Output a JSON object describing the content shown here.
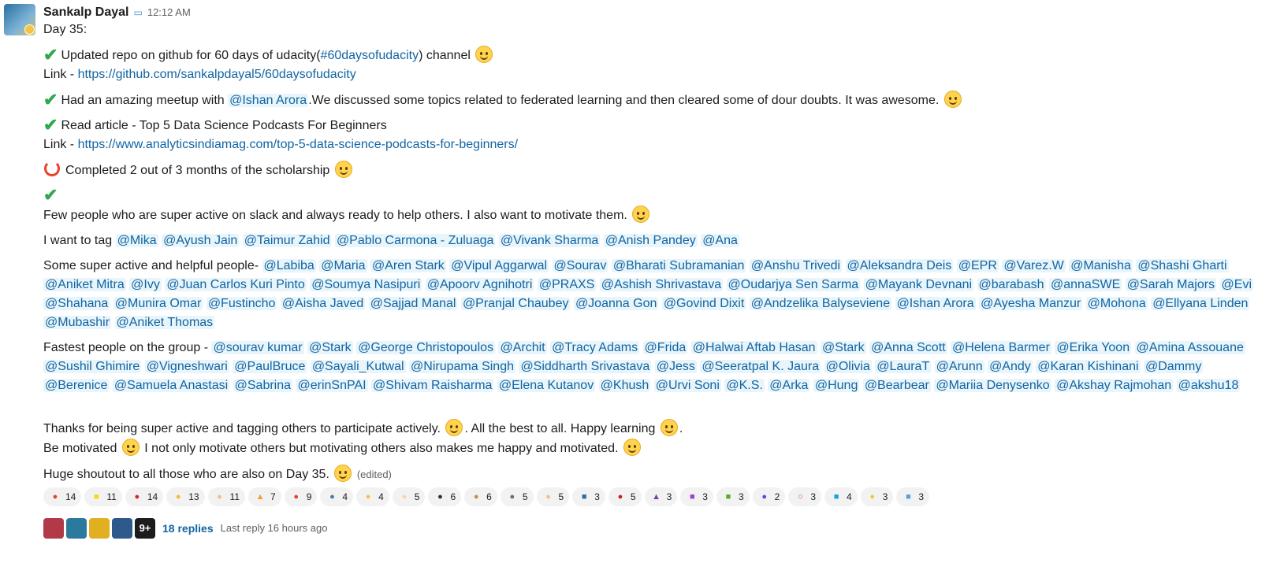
{
  "author": "Sankalp Dayal",
  "status_icon": "speech-balloon",
  "time": "12:12 AM",
  "day_line": "Day 35:",
  "item1": {
    "text_a": "Updated repo on github for 60 days of udacity(",
    "channel": "#60daysofudacity",
    "text_b": ")  channel"
  },
  "link_label": "Link - ",
  "link1": "https://github.com/sankalpdayal5/60daysofudacity",
  "item2": {
    "text_a": "Had an amazing meetup with ",
    "mention": "@Ishan Arora",
    "text_b": ".We discussed some topics related to federated learning and then cleared some of dour doubts. It was awesome."
  },
  "item3": "Read article - Top 5 Data Science Podcasts For Beginners",
  "link2": "https://www.analyticsindiamag.com/top-5-data-science-podcasts-for-beginners/",
  "item4": "Completed 2 out of 3 months of the scholarship",
  "item5": "Few people who are super active on slack and always ready to help others. I also want to motivate them.",
  "tag_intro": "I want to tag ",
  "tag_mentions": [
    "@Mika",
    "@Ayush Jain",
    "@Taimur Zahid",
    "@Pablo Carmona - Zuluaga",
    "@Vivank Sharma",
    "@Anish Pandey",
    "@Ana"
  ],
  "helpful_intro": "Some super active and helpful people- ",
  "helpful_mentions": [
    "@Labiba",
    "@Maria",
    "@Aren Stark",
    "@Vipul Aggarwal",
    "@Sourav",
    "@Bharati Subramanian",
    "@Anshu Trivedi",
    "@Aleksandra Deis",
    "@EPR",
    "@Varez.W",
    "@Manisha",
    "@Shashi Gharti",
    "@Aniket Mitra",
    "@Ivy",
    "@Juan Carlos Kuri Pinto",
    "@Soumya Nasipuri",
    "@Apoorv Agnihotri",
    "@PRAXS",
    "@Ashish Shrivastava",
    "@Oudarjya Sen Sarma",
    "@Mayank Devnani",
    "@barabash",
    "@annaSWE",
    "@Sarah Majors",
    "@Evi",
    "@Shahana",
    "@Munira Omar",
    "@Fustincho",
    "@Aisha Javed",
    "@Sajjad Manal",
    "@Pranjal Chaubey",
    "@Joanna Gon",
    "@Govind Dixit",
    "@Andzelika Balyseviene",
    "@Ishan Arora",
    "@Ayesha Manzur",
    "@Mohona",
    "@Ellyana Linden",
    "@Mubashir",
    "@Aniket Thomas"
  ],
  "fastest_intro": "Fastest people on the group - ",
  "fastest_mentions": [
    "@sourav kumar",
    "@Stark",
    "@George Christopoulos",
    "@Archit",
    "@Tracy Adams",
    "@Frida",
    "@Halwai Aftab Hasan",
    "@Stark",
    "@Anna Scott",
    "@Helena Barmer",
    "@Erika Yoon",
    "@Amina Assouane",
    "@Sushil Ghimire",
    "@Vigneshwari",
    "@PaulBruce",
    "@Sayali_Kutwal",
    "@Nirupama Singh",
    "@Siddharth Srivastava",
    "@Jess",
    "@Seeratpal K. Jaura",
    "@Olivia",
    "@LauraT",
    "@Arunn",
    "@Andy",
    "@Karan Kishinani",
    "@Dammy",
    "@Berenice",
    "@Samuela Anastasi",
    "@Sabrina",
    "@erinSnPAI",
    "@Shivam Raisharma",
    "@Elena Kutanov",
    "@Khush",
    "@Urvi Soni",
    "@K.S.",
    "@Arka",
    "@Hung",
    "@Bearbear",
    "@Mariia Denysenko",
    "@Akshay Rajmohan",
    "@akshu18"
  ],
  "thanks_a": "Thanks for being super active and tagging others to participate actively. ",
  "thanks_b": ". All the best to all. Happy learning ",
  "thanks_c": ".",
  "motivated_a": "Be motivated ",
  "motivated_b": " I not only motivate others but motivating others also makes me happy and motivated.",
  "shoutout": "Huge shoutout to all those who are also on Day 35.",
  "edited": "(edited)",
  "reactions": [
    {
      "icon": "100-flame-icon",
      "color": "#e8412c",
      "glyph": "●",
      "count": "14"
    },
    {
      "icon": "yellow-square-icon",
      "color": "#f5d90a",
      "glyph": "■",
      "count": "11"
    },
    {
      "icon": "fire-circle-icon",
      "color": "#d6261b",
      "glyph": "●",
      "count": "14"
    },
    {
      "icon": "thumbs-up-icon",
      "color": "#f4b73a",
      "glyph": "●",
      "count": "13"
    },
    {
      "icon": "clapping-hands-icon",
      "color": "#f1c27d",
      "glyph": "●",
      "count": "11"
    },
    {
      "icon": "party-popper-icon",
      "color": "#f39c32",
      "glyph": "▲",
      "count": "7"
    },
    {
      "icon": "hundred-icon",
      "color": "#e8412c",
      "glyph": "●",
      "count": "9"
    },
    {
      "icon": "wave-icon",
      "color": "#3d7ea6",
      "glyph": "●",
      "count": "4"
    },
    {
      "icon": "thinking-face-icon",
      "color": "#f4c542",
      "glyph": "●",
      "count": "4"
    },
    {
      "icon": "thumbs-up-light-icon",
      "color": "#f5d3b0",
      "glyph": "●",
      "count": "5"
    },
    {
      "icon": "penguin-icon",
      "color": "#2c2c2c",
      "glyph": "●",
      "count": "6"
    },
    {
      "icon": "person-icon",
      "color": "#c98b43",
      "glyph": "●",
      "count": "6"
    },
    {
      "icon": "robot-icon",
      "color": "#6b6b6b",
      "glyph": "●",
      "count": "5"
    },
    {
      "icon": "raised-hands-icon",
      "color": "#f1c27d",
      "glyph": "●",
      "count": "5"
    },
    {
      "icon": "portrait-icon",
      "color": "#2b6fa1",
      "glyph": "■",
      "count": "3"
    },
    {
      "icon": "m-badge-icon",
      "color": "#c8201c",
      "glyph": "●",
      "count": "5"
    },
    {
      "icon": "runner-icon",
      "color": "#7a3fa3",
      "glyph": "▲",
      "count": "3"
    },
    {
      "icon": "purple-figure-icon",
      "color": "#a23bd6",
      "glyph": "■",
      "count": "3"
    },
    {
      "icon": "green-character-icon",
      "color": "#5caa2b",
      "glyph": "■",
      "count": "3"
    },
    {
      "icon": "rainbow-blob-icon",
      "color": "#6a3fd6",
      "glyph": "●",
      "count": "2"
    },
    {
      "icon": "red-circle-outline-icon",
      "color": "#e8412c",
      "glyph": "○",
      "count": "3"
    },
    {
      "icon": "blue-square-icon",
      "color": "#18a2d8",
      "glyph": "■",
      "count": "4"
    },
    {
      "icon": "grinning-face-icon",
      "color": "#f4c542",
      "glyph": "●",
      "count": "3"
    },
    {
      "icon": "thank-you-icon",
      "color": "#5aa0d6",
      "glyph": "■",
      "count": "3"
    }
  ],
  "thread_avatars": [
    {
      "color": "#b23a48"
    },
    {
      "color": "#2b7a9e"
    },
    {
      "color": "#e0b020"
    },
    {
      "color": "#2d5a8b"
    }
  ],
  "thread_more": "9+",
  "replies": "18 replies",
  "last_reply": "Last reply 16 hours ago"
}
